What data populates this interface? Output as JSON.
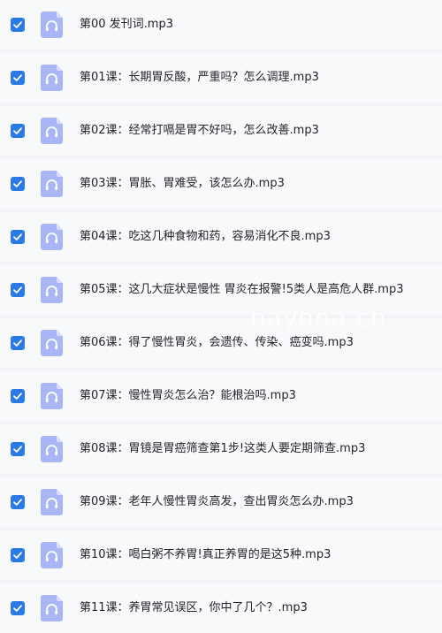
{
  "colors": {
    "checkbox": "#2c7be5",
    "icon_body": "#aab5f5",
    "icon_corner": "#d9defc",
    "row_background": "#f8f9fb",
    "page_background": "#f3f4f7"
  },
  "icons": {
    "checkbox": "checkmark-icon",
    "file": "audio-file-headphones-icon"
  },
  "files": [
    {
      "name": "第00 发刊词.mp3",
      "checked": true
    },
    {
      "name": "第01课：长期胃反酸，严重吗？怎么调理.mp3",
      "checked": true
    },
    {
      "name": "第02课：经常打嗝是胃不好吗，怎么改善.mp3",
      "checked": true
    },
    {
      "name": "第03课：胃胀、胃难受，该怎么办.mp3",
      "checked": true
    },
    {
      "name": "第04课：吃这几种食物和药，容易消化不良.mp3",
      "checked": true
    },
    {
      "name": "第05课：这几大症状是慢性 胃炎在报警!5类人是高危人群.mp3",
      "checked": true
    },
    {
      "name": "第06课：得了慢性胃炎，会遗传、传染、癌变吗.mp3",
      "checked": true
    },
    {
      "name": "第07课：慢性胃炎怎么治？能根治吗.mp3",
      "checked": true
    },
    {
      "name": "第08课：胃镜是胃癌筛查第1步!这类人要定期筛查.mp3",
      "checked": true
    },
    {
      "name": "第09课：老年人慢性胃炎高发，查出胃炎怎么办.mp3",
      "checked": true
    },
    {
      "name": "第10课：喝白粥不养胃!真正养胃的是这5种.mp3",
      "checked": true
    },
    {
      "name": "第11课：养胃常见误区，你中了几个？.mp3",
      "checked": true
    }
  ],
  "watermark": "nayona.cn"
}
